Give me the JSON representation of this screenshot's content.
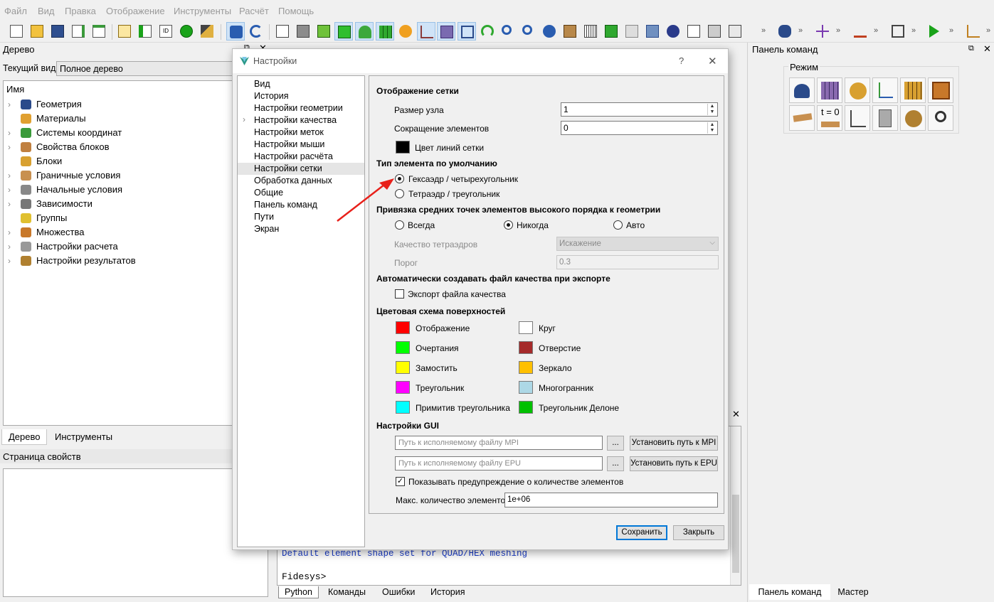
{
  "menu": [
    "Файл",
    "Вид",
    "Правка",
    "Отображение",
    "Инструменты",
    "Расчёт",
    "Помощь"
  ],
  "left_panel": {
    "title": "Дерево",
    "current_view_label": "Текущий вид",
    "current_view_value": "Полное дерево",
    "header_col": "Имя",
    "items": [
      {
        "label": "Геометрия",
        "icon": "geometry-icon",
        "expandable": true
      },
      {
        "label": "Материалы",
        "icon": "materials-icon",
        "expandable": false
      },
      {
        "label": "Системы координат",
        "icon": "coordinate-systems-icon",
        "expandable": true
      },
      {
        "label": "Свойства блоков",
        "icon": "block-properties-icon",
        "expandable": true
      },
      {
        "label": "Блоки",
        "icon": "blocks-icon",
        "expandable": false
      },
      {
        "label": "Граничные условия",
        "icon": "boundary-conditions-icon",
        "expandable": true
      },
      {
        "label": "Начальные условия",
        "icon": "initial-conditions-icon",
        "expandable": true
      },
      {
        "label": "Зависимости",
        "icon": "dependencies-icon",
        "expandable": true
      },
      {
        "label": "Группы",
        "icon": "groups-icon",
        "expandable": false
      },
      {
        "label": "Множества",
        "icon": "sets-icon",
        "expandable": true
      },
      {
        "label": "Настройки расчета",
        "icon": "calc-settings-icon",
        "expandable": true
      },
      {
        "label": "Настройки результатов",
        "icon": "result-settings-icon",
        "expandable": true
      }
    ],
    "tabs": [
      "Дерево",
      "Инструменты"
    ],
    "props_title": "Страница свойств"
  },
  "console": {
    "message": "Default element shape set for QUAD/HEX meshing",
    "prompt": "Fidesys>",
    "tabs": [
      "Python",
      "Команды",
      "Ошибки",
      "История"
    ]
  },
  "right_panel": {
    "title": "Панель команд",
    "group_label": "Режим",
    "t0_label": "t = 0",
    "tabs": [
      "Панель команд",
      "Мастер"
    ]
  },
  "dialog": {
    "title": "Настройки",
    "help": "?",
    "close": "✕",
    "nav": [
      "Вид",
      "История",
      "Настройки геометрии",
      "Настройки качества",
      "Настройки меток",
      "Настройки мыши",
      "Настройки расчёта",
      "Настройки сетки",
      "Обработка данных",
      "Общие",
      "Панель команд",
      "Пути",
      "Экран"
    ],
    "nav_selected": 7,
    "mesh_display": {
      "heading": "Отображение сетки",
      "node_size_label": "Размер узла",
      "node_size_value": "1",
      "shrink_label": "Сокращение элементов",
      "shrink_value": "0",
      "grid_color_label": "Цвет линий сетки",
      "grid_color": "#000000"
    },
    "element_type": {
      "heading": "Тип элемента по умолчанию",
      "hex": "Гексаэдр / четырехугольник",
      "tet": "Тетраэдр / треугольник",
      "selected": "hex"
    },
    "midpoint": {
      "heading": "Привязка средних точек элементов высокого порядка к геометрии",
      "always": "Всегда",
      "never": "Никогда",
      "auto": "Авто",
      "selected": "never",
      "tet_quality_label": "Качество тетраэдров",
      "tet_quality_value": "Искажение",
      "threshold_label": "Порог",
      "threshold_value": "0.3"
    },
    "quality_export": {
      "heading": "Автоматически создавать файл качества при экспорте",
      "checkbox_label": "Экспорт файла качества",
      "checked": false
    },
    "surface_colors": {
      "heading": "Цветовая схема поверхностей",
      "left": [
        {
          "label": "Отображение",
          "color": "#ff0000"
        },
        {
          "label": "Очертания",
          "color": "#00ff00"
        },
        {
          "label": "Замостить",
          "color": "#ffff00"
        },
        {
          "label": "Треугольник",
          "color": "#ff00ff"
        },
        {
          "label": "Примитив треугольника",
          "color": "#00ffff"
        }
      ],
      "right": [
        {
          "label": "Круг",
          "color": "#ffffff"
        },
        {
          "label": "Отверстие",
          "color": "#a52a2a"
        },
        {
          "label": "Зеркало",
          "color": "#ffc000"
        },
        {
          "label": "Многогранник",
          "color": "#add8e6"
        },
        {
          "label": "Треугольник Делоне",
          "color": "#00c000"
        }
      ]
    },
    "gui": {
      "heading": "Настройки GUI",
      "mpi_placeholder": "Путь к исполняемому файлу MPI",
      "epu_placeholder": "Путь к исполняемому файлу EPU",
      "browse": "...",
      "set_mpi": "Установить путь к MPI",
      "set_epu": "Установить путь к EPU",
      "warn_label": "Показывать предупреждение о количестве элементов",
      "warn_checked": true,
      "max_label": "Макс. количество элементов",
      "max_value": "1e+06"
    },
    "save": "Сохранить",
    "close_btn": "Закрыть"
  },
  "accent_color": "#0078d7",
  "arrow_color": "#e8201a"
}
